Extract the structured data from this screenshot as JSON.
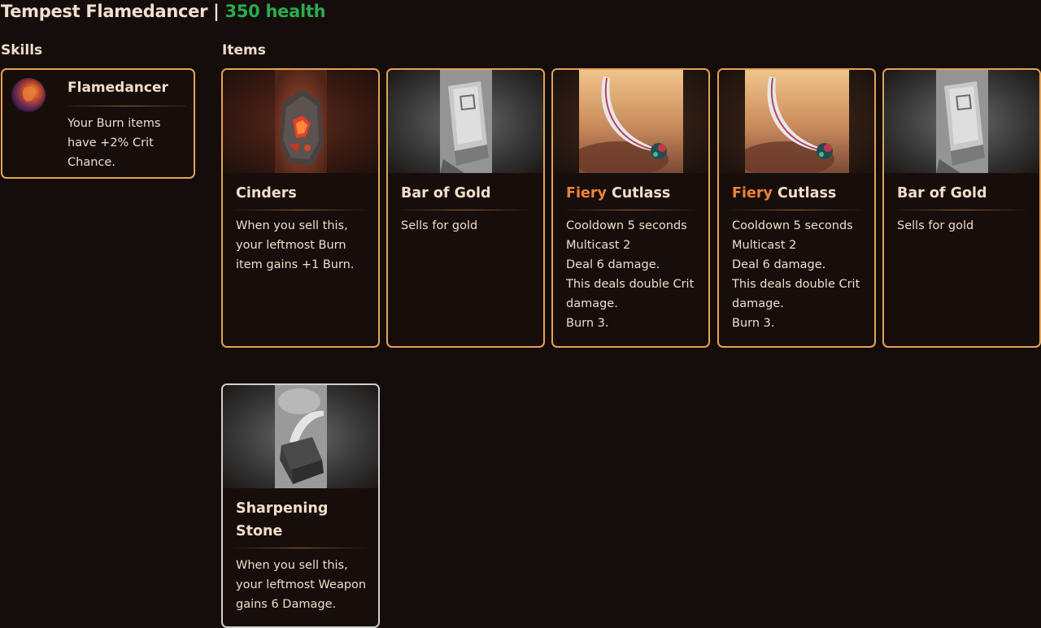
{
  "header": {
    "name": "Tempest Flamedancer",
    "separator": " | ",
    "health": "350 health"
  },
  "skills_label": "Skills",
  "items_label": "Items",
  "skills": [
    {
      "title": "Flamedancer",
      "desc": "Your Burn items have +2% Crit Chance.",
      "icon": "flamedancer-portrait-icon"
    }
  ],
  "items": [
    {
      "title_prefix": "",
      "title": "Cinders",
      "desc_lines": [
        "When you sell this, your leftmost Burn item gains +1 Burn."
      ],
      "icon": "cinders-rock-icon"
    },
    {
      "title_prefix": "",
      "title": "Bar of Gold",
      "desc_lines": [
        "Sells for gold"
      ],
      "icon": "gold-bar-icon"
    },
    {
      "title_prefix": "Fiery",
      "title": "Cutlass",
      "desc_lines": [
        "Cooldown 5 seconds",
        "Multicast 2",
        "Deal 6 damage.",
        "This deals double Crit damage.",
        "Burn 3."
      ],
      "icon": "cutlass-sword-icon"
    },
    {
      "title_prefix": "Fiery",
      "title": "Cutlass",
      "desc_lines": [
        "Cooldown 5 seconds",
        "Multicast 2",
        "Deal 6 damage.",
        "This deals double Crit damage.",
        "Burn 3."
      ],
      "icon": "cutlass-sword-icon"
    },
    {
      "title_prefix": "",
      "title": "Bar of Gold",
      "desc_lines": [
        "Sells for gold"
      ],
      "icon": "gold-bar-icon"
    },
    {
      "title_prefix": "",
      "title": "Sharpening Stone",
      "desc_lines": [
        "When you sell this, your leftmost Weapon gains 6 Damage."
      ],
      "icon": "sharpening-stone-icon"
    }
  ],
  "colors": {
    "background": "#150d0c",
    "card_border": "#e2a257",
    "neutral_border": "#cfcfcf",
    "health": "#2bab4c",
    "fiery": "#f0823c"
  }
}
